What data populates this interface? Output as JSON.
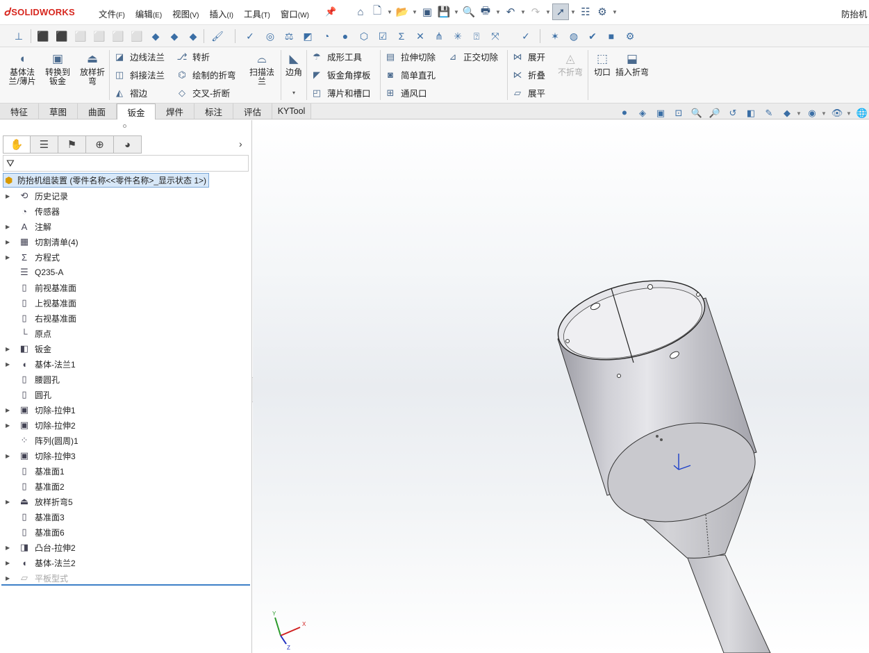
{
  "app": {
    "logo_text": "SOLIDWORKS",
    "window_title": "防抬机"
  },
  "menu": [
    {
      "label": "文件",
      "key": "(F)"
    },
    {
      "label": "编辑",
      "key": "(E)"
    },
    {
      "label": "视图",
      "key": "(V)"
    },
    {
      "label": "插入",
      "key": "(I)"
    },
    {
      "label": "工具",
      "key": "(T)"
    },
    {
      "label": "窗口",
      "key": "(W)"
    }
  ],
  "quick_access_icons": [
    "home-icon",
    "new-file-icon",
    "open-icon",
    "rebuild-icon",
    "save-icon",
    "print-preview-icon",
    "print-icon",
    "undo-icon",
    "redo-icon",
    "select-icon",
    "file-properties-icon",
    "options-icon"
  ],
  "command_manager": {
    "base_flange": "基体法兰/薄片",
    "convert_to_sheet": "转换到钣金",
    "lofted_bend": "放样折弯",
    "edge_flange": "边线法兰",
    "miter_flange": "斜接法兰",
    "hem": "褶边",
    "jog": "转折",
    "sketched_bend": "绘制的折弯",
    "cross_break": "交叉-折断",
    "swept_flange": "扫描法兰",
    "corner": "边角",
    "forming_tool": "成形工具",
    "gusset": "钣金角撑板",
    "tab_and_slot": "薄片和槽口",
    "extruded_cut": "拉伸切除",
    "simple_hole": "简单直孔",
    "vent": "通风口",
    "normal_cut": "正交切除",
    "unfold": "展开",
    "fold": "折叠",
    "flatten": "展平",
    "no_bends": "不折弯",
    "rip": "切口",
    "insert_bends": "插入折弯"
  },
  "tabs": [
    {
      "label": "特征"
    },
    {
      "label": "草图"
    },
    {
      "label": "曲面"
    },
    {
      "label": "钣金",
      "active": true
    },
    {
      "label": "焊件"
    },
    {
      "label": "标注"
    },
    {
      "label": "评估"
    },
    {
      "label": "KYTool"
    }
  ],
  "feature_tree": {
    "root_label": "防抬机组装置  (零件名称<<零件名称>_显示状态 1>)",
    "items": [
      {
        "label": "历史记录",
        "icon": "history-icon",
        "expandable": true
      },
      {
        "label": "传感器",
        "icon": "sensor-icon",
        "expandable": false
      },
      {
        "label": "注解",
        "icon": "annotations-icon",
        "expandable": true
      },
      {
        "label": "切割清单(4)",
        "icon": "cut-list-icon",
        "expandable": true
      },
      {
        "label": "方程式",
        "icon": "equations-icon",
        "expandable": true
      },
      {
        "label": "Q235-A",
        "icon": "material-icon",
        "expandable": false
      },
      {
        "label": "前视基准面",
        "icon": "plane-icon",
        "expandable": false
      },
      {
        "label": "上视基准面",
        "icon": "plane-icon",
        "expandable": false
      },
      {
        "label": "右视基准面",
        "icon": "plane-icon",
        "expandable": false
      },
      {
        "label": "原点",
        "icon": "origin-icon",
        "expandable": false
      },
      {
        "label": "钣金",
        "icon": "sheet-metal-icon",
        "expandable": true
      },
      {
        "label": "基体-法兰1",
        "icon": "base-flange-icon",
        "expandable": true
      },
      {
        "label": "腰圆孔",
        "icon": "plane-icon",
        "expandable": false
      },
      {
        "label": "圆孔",
        "icon": "plane-icon",
        "expandable": false
      },
      {
        "label": "切除-拉伸1",
        "icon": "cut-extrude-icon",
        "expandable": true
      },
      {
        "label": "切除-拉伸2",
        "icon": "cut-extrude-icon",
        "expandable": true
      },
      {
        "label": "阵列(圆周)1",
        "icon": "circular-pattern-icon",
        "expandable": false
      },
      {
        "label": "切除-拉伸3",
        "icon": "cut-extrude-icon",
        "expandable": true
      },
      {
        "label": "基准面1",
        "icon": "plane-icon",
        "expandable": false
      },
      {
        "label": "基准面2",
        "icon": "plane-icon",
        "expandable": false
      },
      {
        "label": "放样折弯5",
        "icon": "lofted-bend-icon",
        "expandable": true
      },
      {
        "label": "基准面3",
        "icon": "plane-icon",
        "expandable": false
      },
      {
        "label": "基准面6",
        "icon": "plane-icon",
        "expandable": false
      },
      {
        "label": "凸台-拉伸2",
        "icon": "boss-extrude-icon",
        "expandable": true
      },
      {
        "label": "基体-法兰2",
        "icon": "base-flange-icon",
        "expandable": true
      },
      {
        "label": "平板型式",
        "icon": "flat-pattern-icon",
        "expandable": true,
        "suppressed": true
      }
    ]
  },
  "triad": {
    "x": "X",
    "y": "Y",
    "z": "Z"
  },
  "colors": {
    "brand": "#d7261e",
    "selection": "#d8e8f8",
    "rollback_bar": "#3d7fc7",
    "model_body": "#c8c8cc"
  }
}
